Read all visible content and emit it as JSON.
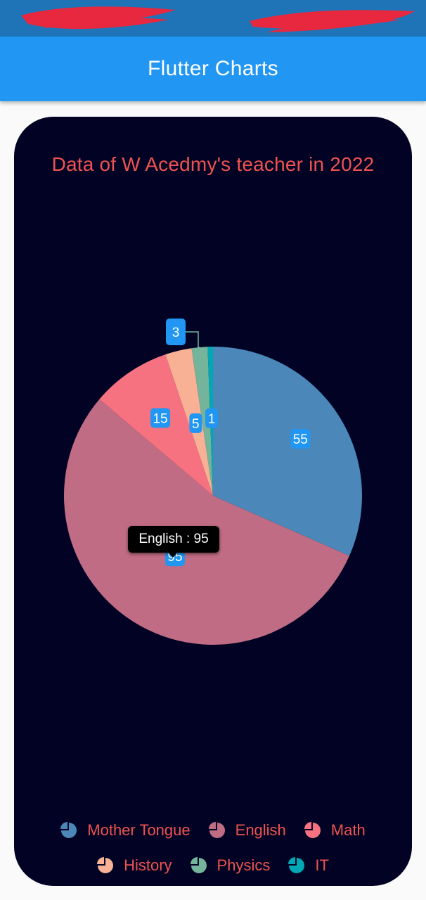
{
  "app_bar": {
    "title": "Flutter Charts"
  },
  "chart_data": {
    "type": "pie",
    "title": "Data of W Acedmy's teacher in 2022",
    "categories": [
      "Mother Tongue",
      "English",
      "Math",
      "History",
      "Physics",
      "IT"
    ],
    "values": [
      55,
      95,
      15,
      5,
      3,
      1
    ],
    "colors": [
      "#4b87b9",
      "#c06c84",
      "#f67280",
      "#f8b195",
      "#74b49b",
      "#00a8b5"
    ],
    "legend_position": "bottom",
    "tooltip": "English : 95"
  },
  "colors": {
    "status_bar": "#1f74b8",
    "app_bar": "#2196f3",
    "card_background": "#010224",
    "title_text": "#ef5350",
    "data_label_bg": "#2196f3"
  }
}
